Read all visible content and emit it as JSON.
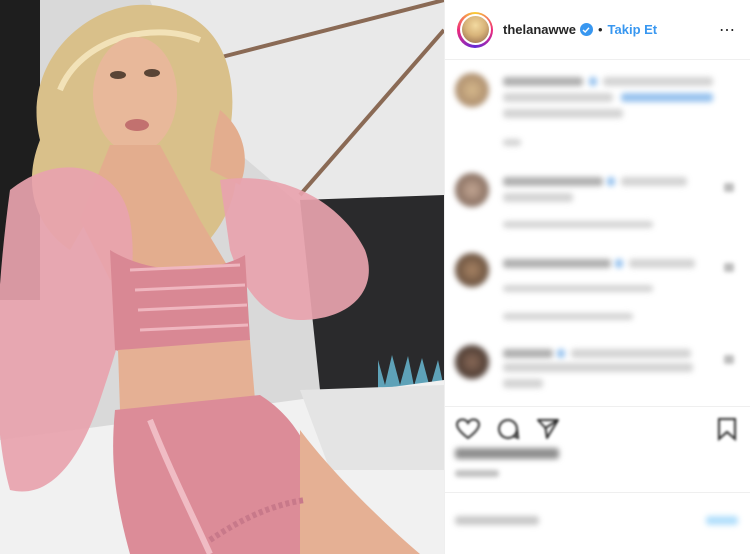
{
  "post": {
    "username": "thelanawwe",
    "separator": "•",
    "follow_label": "Takip Et",
    "more_label": "⋯"
  },
  "colors": {
    "accent": "#3897f0",
    "outfit_pink": "#e59aa6",
    "hair": "#d9c08a"
  },
  "icons": {
    "verified": "verified-badge-icon",
    "like": "heart-icon",
    "comment": "comment-icon",
    "share": "share-icon",
    "save": "bookmark-icon",
    "more": "more-options-icon"
  },
  "comments": {
    "blurred": true,
    "count_visible": 4
  }
}
